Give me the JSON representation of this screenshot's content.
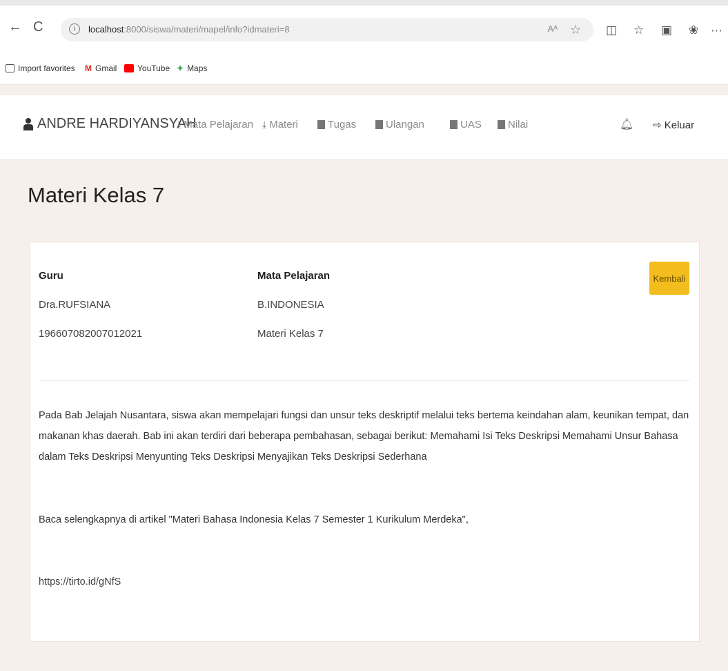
{
  "browser": {
    "url_host": "localhost",
    "url_path": ":8000/siswa/materi/mapel/info?idmateri=8",
    "back_glyph": "←",
    "reload_glyph": "C",
    "read_aloud_glyph": "Aᴬ",
    "favorite_glyph": "☆",
    "more_glyph": "···"
  },
  "bookmarks": [
    {
      "label": "Import favorites",
      "color": "#555555"
    },
    {
      "label": "Gmail",
      "color": "#d93025"
    },
    {
      "label": "YouTube",
      "color": "#ff0000"
    },
    {
      "label": "Maps",
      "color": "#34a853"
    }
  ],
  "app_nav": {
    "user_name": "ANDRE HARDIYANSYAH",
    "items": [
      "Mata Pelajaran",
      "Materi",
      "Tugas",
      "Ulangan",
      "UAS",
      "Nilai"
    ],
    "logout_label": "Keluar",
    "logout_glyph": "⇨"
  },
  "page": {
    "title": "Materi Kelas 7"
  },
  "card": {
    "guru_label": "Guru",
    "guru_name": "Dra.RUFSIANA",
    "guru_nip": "196607082007012021",
    "mapel_label": "Mata Pelajaran",
    "mapel_name": "B.INDONESIA",
    "mapel_materi": "Materi Kelas 7",
    "back_button": "Kembali",
    "description": "Pada Bab Jelajah Nusantara, siswa akan mempelajari fungsi dan unsur teks deskriptif melalui teks bertema keindahan alam, keunikan tempat, dan makanan khas daerah. Bab ini akan terdiri dari beberapa pembahasan, sebagai berikut: Memahami Isi Teks Deskripsi Memahami Unsur Bahasa dalam Teks Deskripsi Menyunting Teks Deskripsi Menyajikan Teks Deskripsi Sederhana",
    "read_more": "Baca selengkapnya di artikel \"Materi Bahasa Indonesia Kelas 7 Semester 1 Kurikulum Merdeka\",",
    "link": "https://tirto.id/gNfS"
  },
  "colors": {
    "page_bg": "#f6efec",
    "accent_button": "#f2bd1d"
  }
}
